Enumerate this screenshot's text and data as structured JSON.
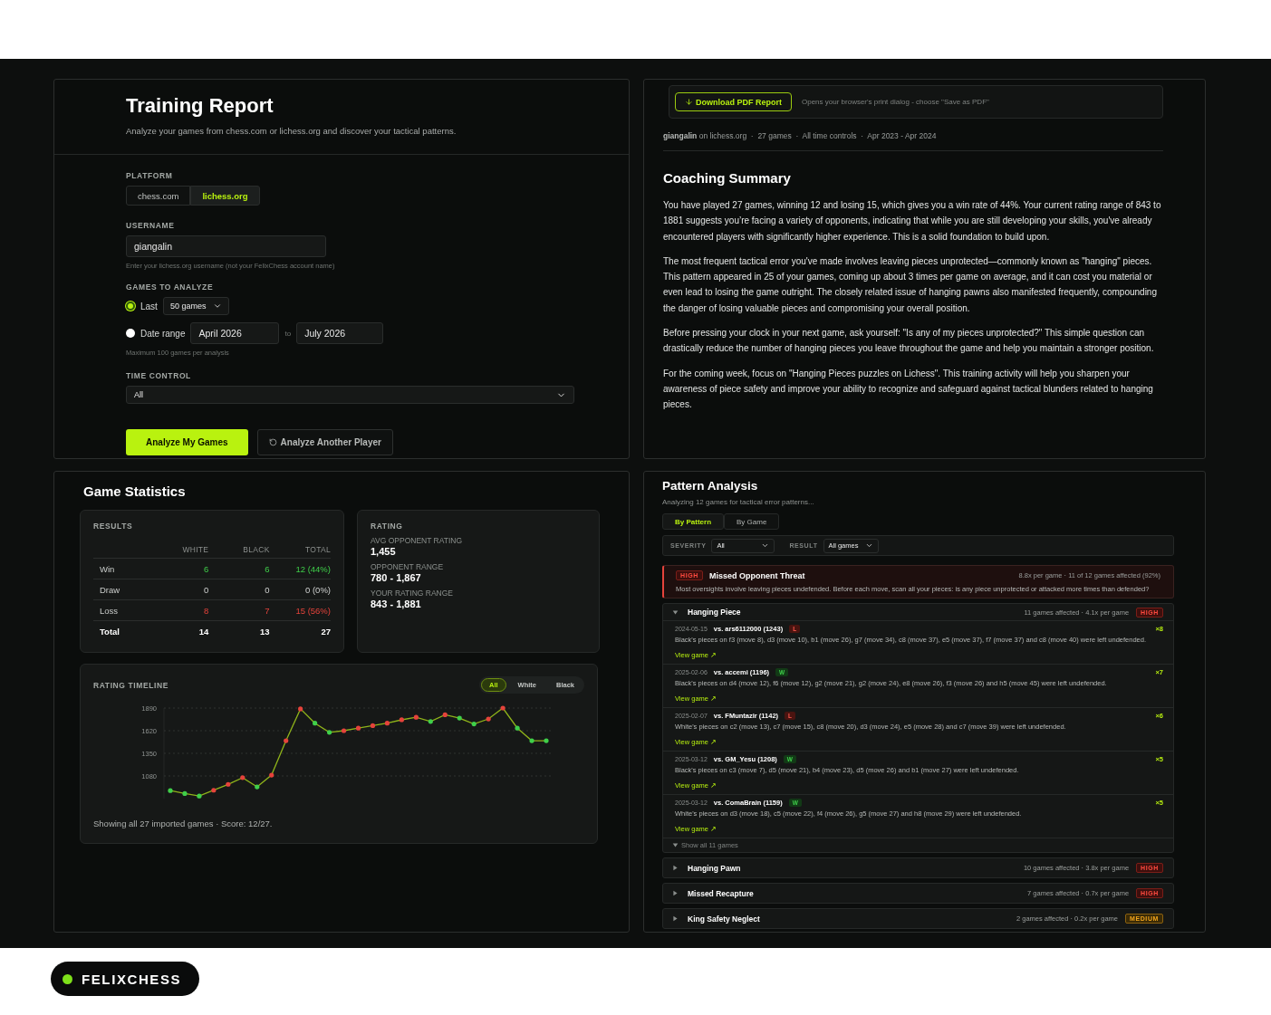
{
  "training_report": {
    "title": "Training Report",
    "subtitle": "Analyze your games from chess.com or lichess.org and discover your tactical patterns.",
    "platform": {
      "label": "PLATFORM",
      "options": [
        {
          "label": "chess.com",
          "selected": false
        },
        {
          "label": "lichess.org",
          "selected": true
        }
      ]
    },
    "username": {
      "label": "USERNAME",
      "value": "giangalin",
      "hint": "Enter your lichess.org username (not your FelixChess account name)"
    },
    "games_to_analyze": {
      "label": "GAMES TO ANALYZE",
      "options": [
        {
          "kind": "count",
          "label": "Last",
          "selected": true,
          "value": "50 games"
        },
        {
          "kind": "range",
          "label": "Date range",
          "selected": false,
          "from": "April 2026",
          "separator": "to",
          "to": "July 2026"
        }
      ],
      "hint": "Maximum 100 games per analysis"
    },
    "time_control": {
      "label": "TIME CONTROL",
      "value": "All"
    },
    "buttons": [
      {
        "kind": "primary",
        "label": "Analyze My Games"
      },
      {
        "kind": "secondary",
        "label": "Analyze Another Player"
      }
    ]
  },
  "report": {
    "download_button": "Download PDF Report",
    "download_hint": "Opens your browser's print dialog - choose \"Save as PDF\"",
    "meta": "**giangalin** on lichess.org  ·  27 games  ·  All time controls  ·  Apr 2023 - Apr 2024",
    "title": "Coaching Summary",
    "paragraphs": [
      "You have played 27 games, winning 12 and losing 15, which gives you a win rate of 44%. Your current rating range of 843 to 1881 suggests you’re facing a variety of opponents, indicating that while you are still developing your skills, you've already encountered players with significantly higher experience. This is a solid foundation to build upon.",
      "The most frequent tactical error you've made involves leaving pieces unprotected—commonly known as \"hanging\" pieces. This pattern appeared in 25 of your games, coming up about 3 times per game on average, and it can cost you material or even lead to losing the game outright. The closely related issue of hanging pawns also manifested frequently, compounding the danger of losing valuable pieces and compromising your overall position.",
      "Before pressing your clock in your next game, ask yourself: \"Is any of my pieces unprotected?\" This simple question can drastically reduce the number of hanging pieces you leave throughout the game and help you maintain a stronger position.",
      "For the coming week, focus on \"Hanging Pieces puzzles on Lichess\". This training activity will help you sharpen your awareness of piece safety and improve your ability to recognize and safeguard against tactical blunders related to hanging pieces."
    ]
  },
  "game_statistics": {
    "title": "Game Statistics",
    "results": {
      "label": "RESULTS",
      "columns": [
        "WHITE",
        "BLACK",
        "TOTAL"
      ],
      "rows": [
        {
          "kind": "win",
          "label": "Win",
          "cells": [
            "6",
            "6",
            "12 (44%)"
          ]
        },
        {
          "kind": "draw",
          "label": "Draw",
          "cells": [
            "0",
            "0",
            "0 (0%)"
          ]
        },
        {
          "kind": "loss",
          "label": "Loss",
          "cells": [
            "8",
            "7",
            "15 (56%)"
          ]
        },
        {
          "kind": "total",
          "label": "Total",
          "cells": [
            "14",
            "13",
            "27"
          ]
        }
      ]
    },
    "rating": {
      "label": "RATING",
      "stats": [
        {
          "label": "AVG OPPONENT RATING",
          "value": "1,455"
        },
        {
          "label": "OPPONENT RANGE",
          "value": "780 - 1,867"
        },
        {
          "label": "YOUR RATING RANGE",
          "value": "843 - 1,881"
        }
      ]
    },
    "timeline": {
      "label": "RATING TIMELINE",
      "filters": [
        {
          "label": "All",
          "selected": true
        },
        {
          "label": "White",
          "selected": false
        },
        {
          "label": "Black",
          "selected": false
        }
      ],
      "points": [
        {
          "won": true
        },
        {
          "won": true
        },
        {
          "won": true
        },
        {
          "won": false
        },
        {
          "won": false
        },
        {
          "won": false
        },
        {
          "won": true
        },
        {
          "won": false
        },
        {
          "won": false
        },
        {
          "won": false
        },
        {
          "won": true
        },
        {
          "won": true
        },
        {
          "won": false
        },
        {
          "won": false
        },
        {
          "won": false
        },
        {
          "won": false
        },
        {
          "won": false
        },
        {
          "won": false
        },
        {
          "won": true
        },
        {
          "won": false
        },
        {
          "won": true
        },
        {
          "won": true
        },
        {
          "won": false
        },
        {
          "won": false
        },
        {
          "won": true
        },
        {
          "won": true
        },
        {
          "won": true
        }
      ],
      "chart_data": {
        "type": "line",
        "grid": true,
        "ylim": [
          810,
          1890
        ],
        "yticks": [
          1080,
          1350,
          1620,
          1890
        ],
        "series": [
          {
            "color": "#8fb31a",
            "values": [
              905,
              870,
              840,
              910,
              980,
              1060,
              950,
              1090,
              1500,
              1880,
              1710,
              1600,
              1620,
              1650,
              1680,
              1710,
              1750,
              1780,
              1730,
              1810,
              1770,
              1700,
              1760,
              1890,
              1650,
              1500,
              1500
            ]
          }
        ]
      },
      "footer": "Showing all 27 imported games · Score: 12/27."
    }
  },
  "pattern_analysis": {
    "title": "Pattern Analysis",
    "subtitle": "Analyzing 12 games for tactical error patterns...",
    "tabs": [
      {
        "label": "By Pattern",
        "selected": true
      },
      {
        "label": "By Game",
        "selected": false
      }
    ],
    "filters": [
      {
        "label": "SEVERITY",
        "value": "All"
      },
      {
        "label": "RESULT",
        "value": "All games"
      }
    ],
    "highlight": {
      "kind": "high",
      "badge": "HIGH",
      "title": "Missed Opponent Threat",
      "stats": "8.8x per game · 11 of 12 games affected (92%)",
      "description": "Most oversights involve leaving pieces undefended. Before each move, scan all your pieces: is any piece unprotected or attacked more times than defended?"
    },
    "patterns": [
      {
        "title": "Hanging Piece",
        "stats": "11 games affected · 4.1x per game",
        "kind": "high",
        "badge": "HIGH",
        "expanded": true,
        "games": [
          {
            "date": "2024-05-15",
            "opponent": "vs. ars6112000 (1243)",
            "kind": "loss",
            "result_label": "L",
            "description": "Black's pieces on f3 (move 8), d3 (move 10), b1 (move 26), g7 (move 34), c8 (move 37), e5 (move 37), f7 (move 37) and c8 (move 40) were left undefended.",
            "link": "View game ↗",
            "count": "×8"
          },
          {
            "date": "2025-02-06",
            "opponent": "vs. accemi (1196)",
            "kind": "win",
            "result_label": "W",
            "description": "Black's pieces on d4 (move 12), f6 (move 12), g2 (move 21), g2 (move 24), e8 (move 26), f3 (move 26) and h5 (move 45) were left undefended.",
            "link": "View game ↗",
            "count": "×7"
          },
          {
            "date": "2025-02-07",
            "opponent": "vs. FMuntazir (1142)",
            "kind": "loss",
            "result_label": "L",
            "description": "White's pieces on c2 (move 13), c7 (move 15), c8 (move 20), d3 (move 24), e5 (move 28) and c7 (move 39) were left undefended.",
            "link": "View game ↗",
            "count": "×6"
          },
          {
            "date": "2025-03-12",
            "opponent": "vs. GM_Yesu (1208)",
            "kind": "win",
            "result_label": "W",
            "description": "Black's pieces on c3 (move 7), d5 (move 21), b4 (move 23), d5 (move 26) and b1 (move 27) were left undefended.",
            "link": "View game ↗",
            "count": "×5"
          },
          {
            "date": "2025-03-12",
            "opponent": "vs. ComaBrain (1159)",
            "kind": "win",
            "result_label": "W",
            "description": "White's pieces on d3 (move 18), c5 (move 22), f4 (move 26), g5 (move 27) and h8 (move 29) were left undefended.",
            "link": "View game ↗",
            "count": "×5"
          }
        ],
        "show_all": "Show all 11 games"
      },
      {
        "title": "Hanging Pawn",
        "stats": "10 games affected · 3.8x per game",
        "kind": "high",
        "badge": "HIGH",
        "expanded": false
      },
      {
        "title": "Missed Recapture",
        "stats": "7 games affected · 0.7x per game",
        "kind": "high",
        "badge": "HIGH",
        "expanded": false
      },
      {
        "title": "King Safety Neglect",
        "stats": "2 games affected · 0.2x per game",
        "kind": "medium",
        "badge": "MEDIUM",
        "expanded": false
      }
    ]
  },
  "brand": {
    "name": "FELIXCHESS"
  }
}
